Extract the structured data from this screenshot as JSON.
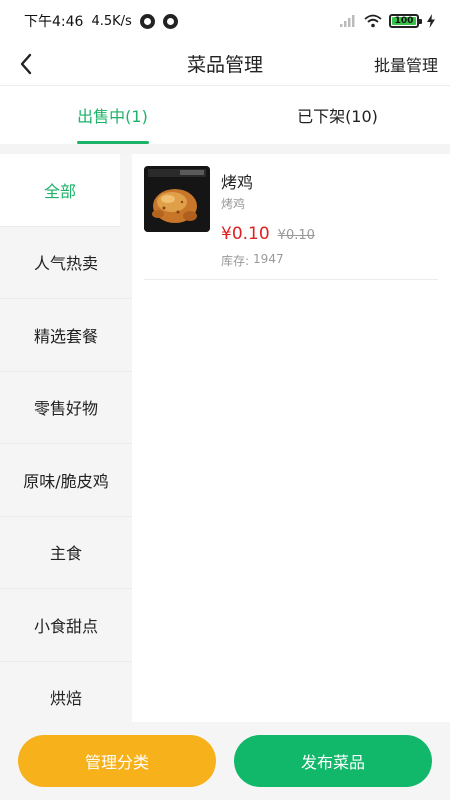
{
  "status_bar": {
    "time": "下午4:46",
    "net_speed": "4.5K/s",
    "battery_level": "100",
    "battery_fraction": 1.0
  },
  "header": {
    "title": "菜品管理",
    "batch_label": "批量管理"
  },
  "tabs": [
    {
      "label": "出售中(1)",
      "active": true
    },
    {
      "label": "已下架(10)",
      "active": false
    }
  ],
  "categories": [
    {
      "label": "全部",
      "active": true
    },
    {
      "label": "人气热卖"
    },
    {
      "label": "精选套餐"
    },
    {
      "label": "零售好物"
    },
    {
      "label": "原味/脆皮鸡"
    },
    {
      "label": "主食"
    },
    {
      "label": "小食甜点"
    },
    {
      "label": "烘焙"
    }
  ],
  "products": [
    {
      "name": "烤鸡",
      "subtitle": "烤鸡",
      "price": "¥0.10",
      "original_price": "¥0.10",
      "stock_label": "库存:",
      "stock_value": "1947"
    }
  ],
  "bottom": {
    "manage_label": "管理分类",
    "publish_label": "发布菜品"
  },
  "colors": {
    "accent": "#1db269",
    "price": "#e02020",
    "manage_button": "#f7b11a",
    "publish_button": "#11b86a"
  },
  "icons": [
    "signal-icon",
    "wifi-icon",
    "battery-icon",
    "charging-icon",
    "back-arrow-icon",
    "app-notification-icon"
  ]
}
